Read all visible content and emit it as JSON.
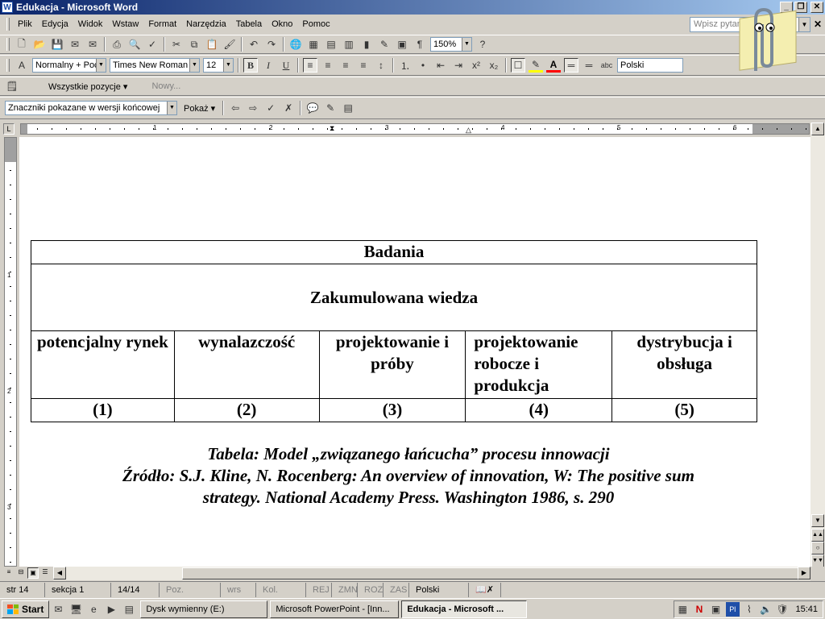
{
  "window": {
    "title": "Edukacja - Microsoft Word",
    "app_letter": "W"
  },
  "menu": {
    "items": [
      "Plik",
      "Edycja",
      "Widok",
      "Wstaw",
      "Format",
      "Narzędzia",
      "Tabela",
      "Okno",
      "Pomoc"
    ],
    "ask_placeholder": "Wpisz pytanie"
  },
  "standard_toolbar": {
    "zoom": "150%"
  },
  "formatting_toolbar": {
    "style": "Normalny + Poç",
    "font": "Times New Roman",
    "size": "12",
    "bold": "B",
    "italic": "I",
    "underline": "U",
    "language": "Polski"
  },
  "review_toolbar": {
    "all_items": "Wszystkie pozycje ▾",
    "new_comment": "Nowy..."
  },
  "markup_toolbar": {
    "display_mode": "Znaczniki pokazane w wersji końcowej",
    "show": "Pokaż ▾"
  },
  "ruler": {
    "numbers": [
      "1",
      "2",
      "3",
      "4",
      "5",
      "6"
    ],
    "vnumbers": [
      "1",
      "2",
      "3"
    ]
  },
  "document": {
    "table": {
      "header": "Badania",
      "accumulated": "Zakumulowana wiedza",
      "stages": [
        "potencjalny rynek",
        "wynalazczość",
        "projektowanie i próby",
        "projektowanie robocze i produkcja",
        "dystrybucja i obsługa"
      ],
      "numbers": [
        "(1)",
        "(2)",
        "(3)",
        "(4)",
        "(5)"
      ]
    },
    "caption": {
      "line1": "Tabela: Model „związanego łańcucha” procesu innowacji",
      "line2": "Źródło: S.J. Kline, N. Rocenberg: An overview of innovation, W: The positive sum",
      "line3": "strategy. National Academy Press. Washington 1986, s. 290"
    }
  },
  "status": {
    "page": "str 14",
    "section": "sekcja 1",
    "pages": "14/14",
    "pos": "Poz.",
    "line": "wrs",
    "col": "Kol.",
    "rec": "REJ",
    "trk": "ZMN",
    "ext": "ROZ",
    "ovr": "ZAS",
    "language": "Polski"
  },
  "taskbar": {
    "start": "Start",
    "tasks": [
      "Dysk wymienny (E:)",
      "Microsoft PowerPoint - [Inn...",
      "Edukacja - Microsoft ..."
    ],
    "clock": "15:41"
  },
  "colors": {
    "title_start": "#0a246a",
    "title_end": "#a6caf0",
    "highlight": "#ffff00",
    "font_color": "#ff0000"
  }
}
